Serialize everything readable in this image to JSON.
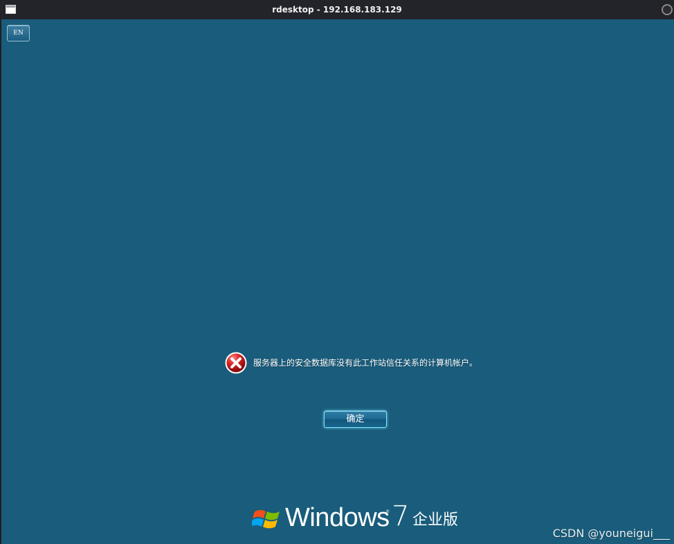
{
  "window": {
    "title": "rdesktop - 192.168.183.129",
    "icons": {
      "window": "window-icon",
      "control": "window-control-icon"
    }
  },
  "login": {
    "language_button": "EN",
    "message": "服务器上的安全数据库没有此工作站信任关系的计算机帐户。",
    "ok_button": "确定",
    "error_icon": "error-icon"
  },
  "branding": {
    "windows": "Windows",
    "registered": "®",
    "version": "7",
    "edition": "企业版",
    "logo_icon": "windows-flag-icon"
  },
  "watermark": "CSDN @youneigui___",
  "colors": {
    "desktop_background": "#195c7b",
    "titlebar_background": "#23232a",
    "button_glow": "#7ee6ff"
  }
}
